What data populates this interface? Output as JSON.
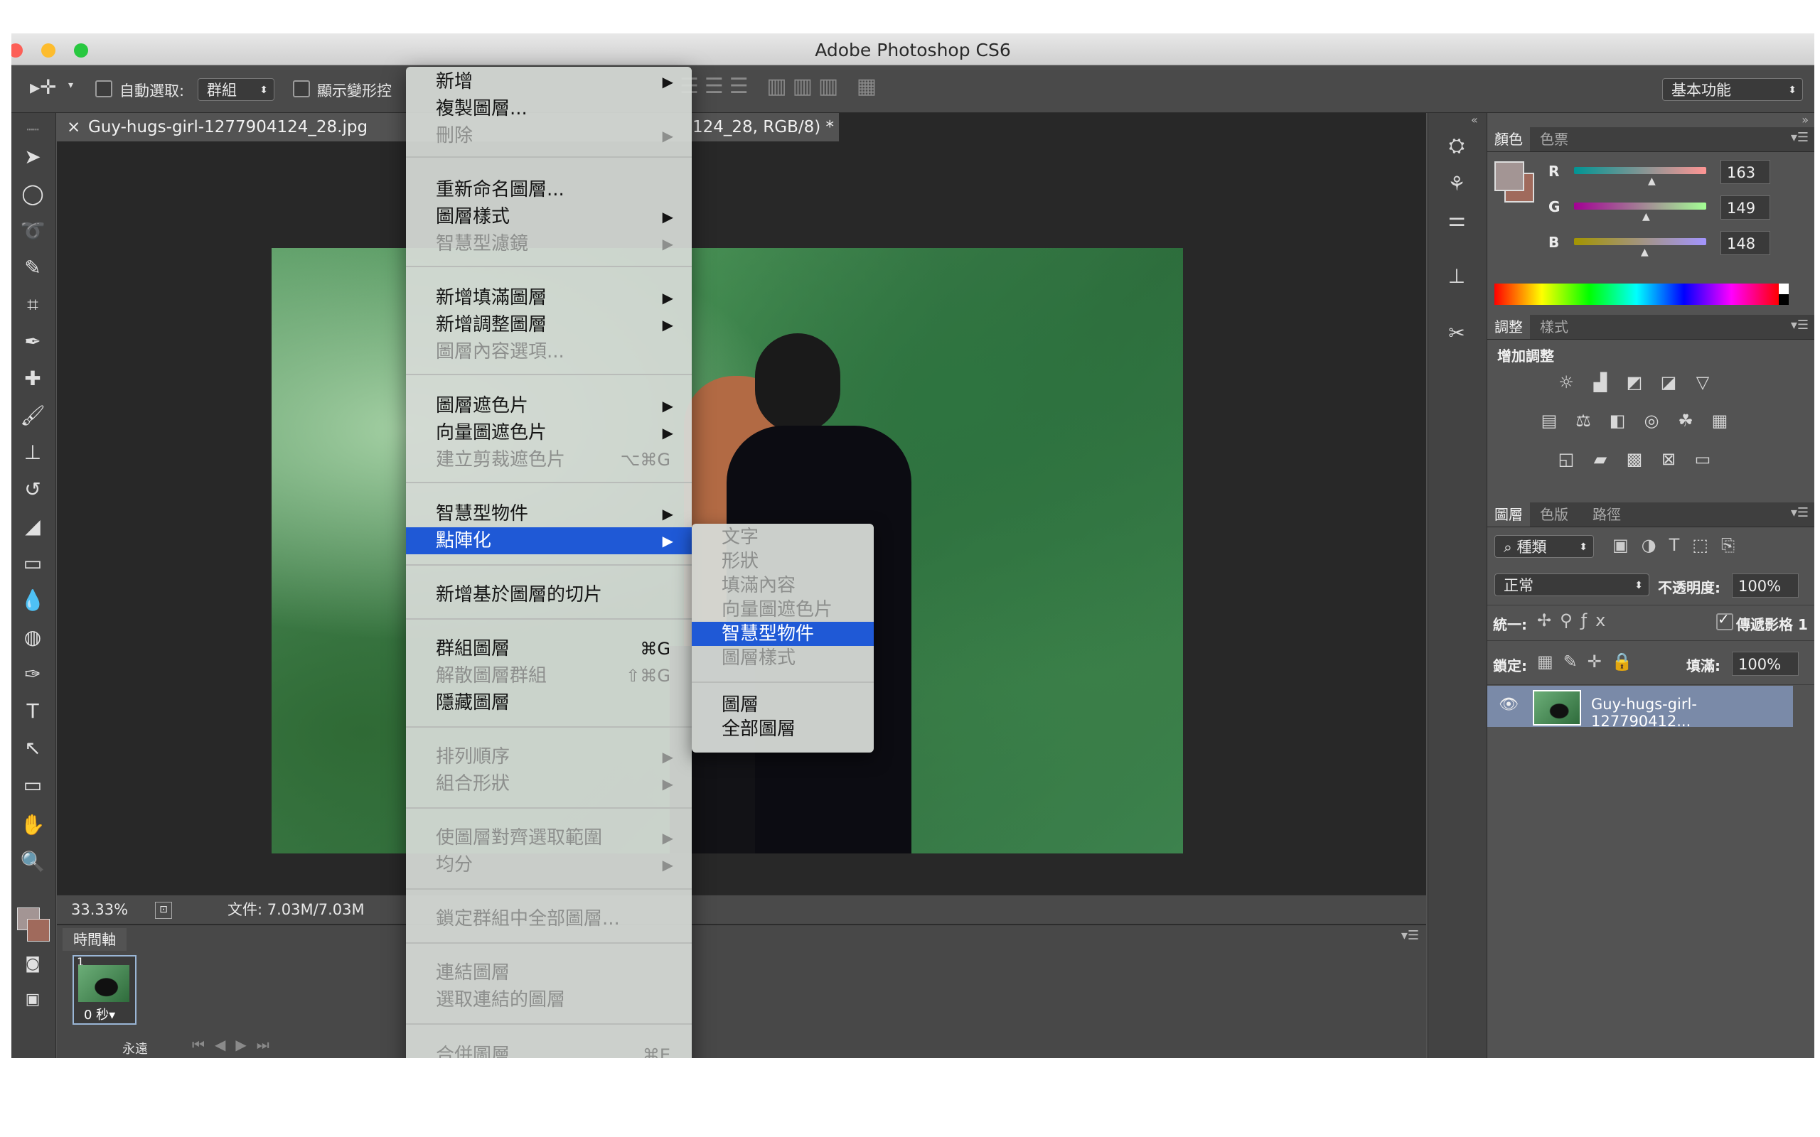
{
  "window": {
    "title": "Adobe Photoshop CS6"
  },
  "options_bar": {
    "auto_select_label": "自動選取:",
    "auto_select_value": "群組",
    "show_transform_label": "顯示變形控",
    "workspace": "基本功能"
  },
  "document": {
    "tab_close": "×",
    "tab_title": "Guy-hugs-girl-1277904124_28.jpg",
    "tab_title_tail": "124_28, RGB/8) *",
    "zoom": "33.33%",
    "file_info": "文件: 7.03M/7.03M"
  },
  "timeline": {
    "tab": "時間軸",
    "frame_number": "1",
    "frame_delay": "0 秒▾",
    "loop": "永遠"
  },
  "color_panel": {
    "tabs": [
      "顏色",
      "色票"
    ],
    "r_label": "R",
    "g_label": "G",
    "b_label": "B",
    "r": "163",
    "g": "149",
    "b": "148",
    "foreground_color": "#a39594",
    "background_color": "#a06a5c"
  },
  "adjust_panel": {
    "tabs": [
      "調整",
      "樣式"
    ],
    "heading": "增加調整"
  },
  "layers_panel": {
    "tabs": [
      "圖層",
      "色版",
      "路徑"
    ],
    "filter_kind": "種類",
    "blend_mode": "正常",
    "opacity_label": "不透明度:",
    "opacity": "100%",
    "unify_label": "統一:",
    "propagate_label": "傳遞影格 1",
    "lock_label": "鎖定:",
    "fill_label": "填滿:",
    "fill": "100%",
    "layer_name": "Guy-hugs-girl-127790412..."
  },
  "main_menu": {
    "items": [
      {
        "label": "新增",
        "arrow": "▶"
      },
      {
        "label": "複製圖層..."
      },
      {
        "label": "刪除",
        "arrow": "▶"
      },
      {
        "label": "重新命名圖層..."
      },
      {
        "label": "圖層樣式",
        "arrow": "▶"
      },
      {
        "label": "智慧型濾鏡",
        "arrow": "▶"
      },
      {
        "label": "新增填滿圖層",
        "arrow": "▶"
      },
      {
        "label": "新增調整圖層",
        "arrow": "▶"
      },
      {
        "label": "圖層內容選項..."
      },
      {
        "label": "圖層遮色片",
        "arrow": "▶"
      },
      {
        "label": "向量圖遮色片",
        "arrow": "▶"
      },
      {
        "label": "建立剪裁遮色片",
        "shortcut": "⌥⌘G"
      },
      {
        "label": "智慧型物件",
        "arrow": "▶"
      },
      {
        "label": "點陣化",
        "arrow": "▶"
      },
      {
        "label": "新增基於圖層的切片"
      },
      {
        "label": "群組圖層",
        "shortcut": "⌘G"
      },
      {
        "label": "解散圖層群組",
        "shortcut": "⇧⌘G"
      },
      {
        "label": "隱藏圖層"
      },
      {
        "label": "排列順序",
        "arrow": "▶"
      },
      {
        "label": "組合形狀",
        "arrow": "▶"
      },
      {
        "label": "使圖層對齊選取範圍",
        "arrow": "▶"
      },
      {
        "label": "均分",
        "arrow": "▶"
      },
      {
        "label": "鎖定群組中全部圖層..."
      },
      {
        "label": "連結圖層"
      },
      {
        "label": "選取連結的圖層"
      },
      {
        "label": "合併圖層",
        "shortcut": "⌘E"
      }
    ],
    "scroll_arrow": "▼"
  },
  "submenu": {
    "items": [
      "文字",
      "形狀",
      "填滿內容",
      "向量圖遮色片",
      "智慧型物件",
      "圖層樣式",
      "圖層",
      "全部圖層"
    ]
  }
}
